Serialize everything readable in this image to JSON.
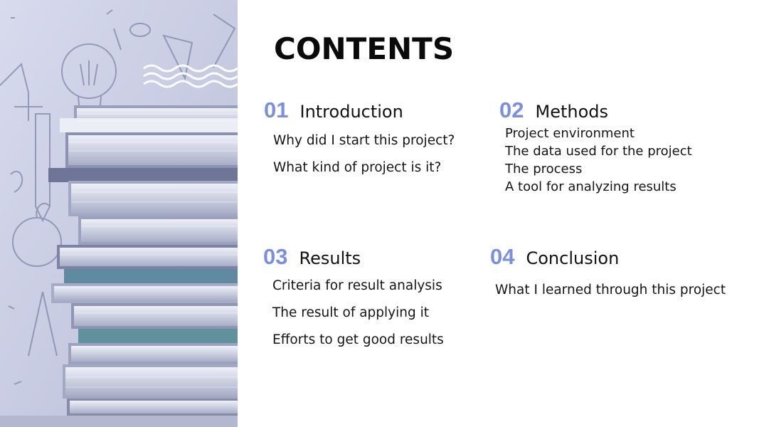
{
  "title": "CONTENTS",
  "sections": [
    {
      "number": "01",
      "heading": "Introduction",
      "items": [
        "Why did I start this project?",
        "What kind of project is it?"
      ]
    },
    {
      "number": "02",
      "heading": "Methods",
      "items": [
        "Project environment",
        "The data used for the project",
        "The process",
        "A tool for analyzing results"
      ]
    },
    {
      "number": "03",
      "heading": "Results",
      "items": [
        "Criteria for result analysis",
        "The result of applying it",
        "Efforts to get good results"
      ]
    },
    {
      "number": "04",
      "heading": "Conclusion",
      "items": [
        "What I learned through this project"
      ]
    }
  ],
  "colors": {
    "accent": "#7b8fe0",
    "photo_tint": "#c9ccdf",
    "text": "#111111"
  },
  "image": {
    "description_icon": "book-stack-photo"
  }
}
